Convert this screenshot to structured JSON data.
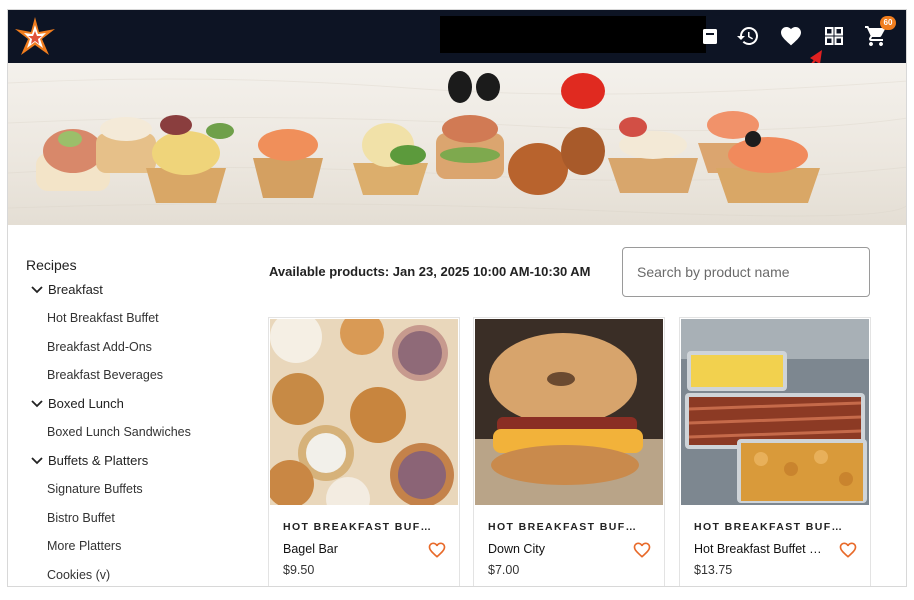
{
  "header": {
    "cart_count": "60",
    "colors": {
      "bar": "#0d1424",
      "accent": "#f07d1e"
    },
    "icons": [
      "calendar-icon",
      "history-icon",
      "favorites-heart-icon",
      "grid-view-icon",
      "cart-icon"
    ]
  },
  "sidebar": {
    "title": "Recipes",
    "categories": [
      {
        "label": "Breakfast",
        "items": [
          "Hot Breakfast Buffet",
          "Breakfast Add-Ons",
          "Breakfast Beverages"
        ]
      },
      {
        "label": "Boxed Lunch",
        "items": [
          "Boxed Lunch Sandwiches"
        ]
      },
      {
        "label": "Buffets & Platters",
        "items": [
          "Signature Buffets",
          "Bistro Buffet",
          "More Platters",
          "Cookies (v)"
        ]
      }
    ]
  },
  "main": {
    "available_text": "Available products: Jan 23, 2025 10:00 AM-10:30 AM",
    "search_placeholder": "Search by product name",
    "products": [
      {
        "category": "HOT BREAKFAST BUF…",
        "name": "Bagel Bar",
        "price": "$9.50"
      },
      {
        "category": "HOT BREAKFAST BUF…",
        "name": "Down City",
        "price": "$7.00"
      },
      {
        "category": "HOT BREAKFAST BUF…",
        "name": "Hot Breakfast Buffet …",
        "price": "$13.75"
      }
    ]
  }
}
